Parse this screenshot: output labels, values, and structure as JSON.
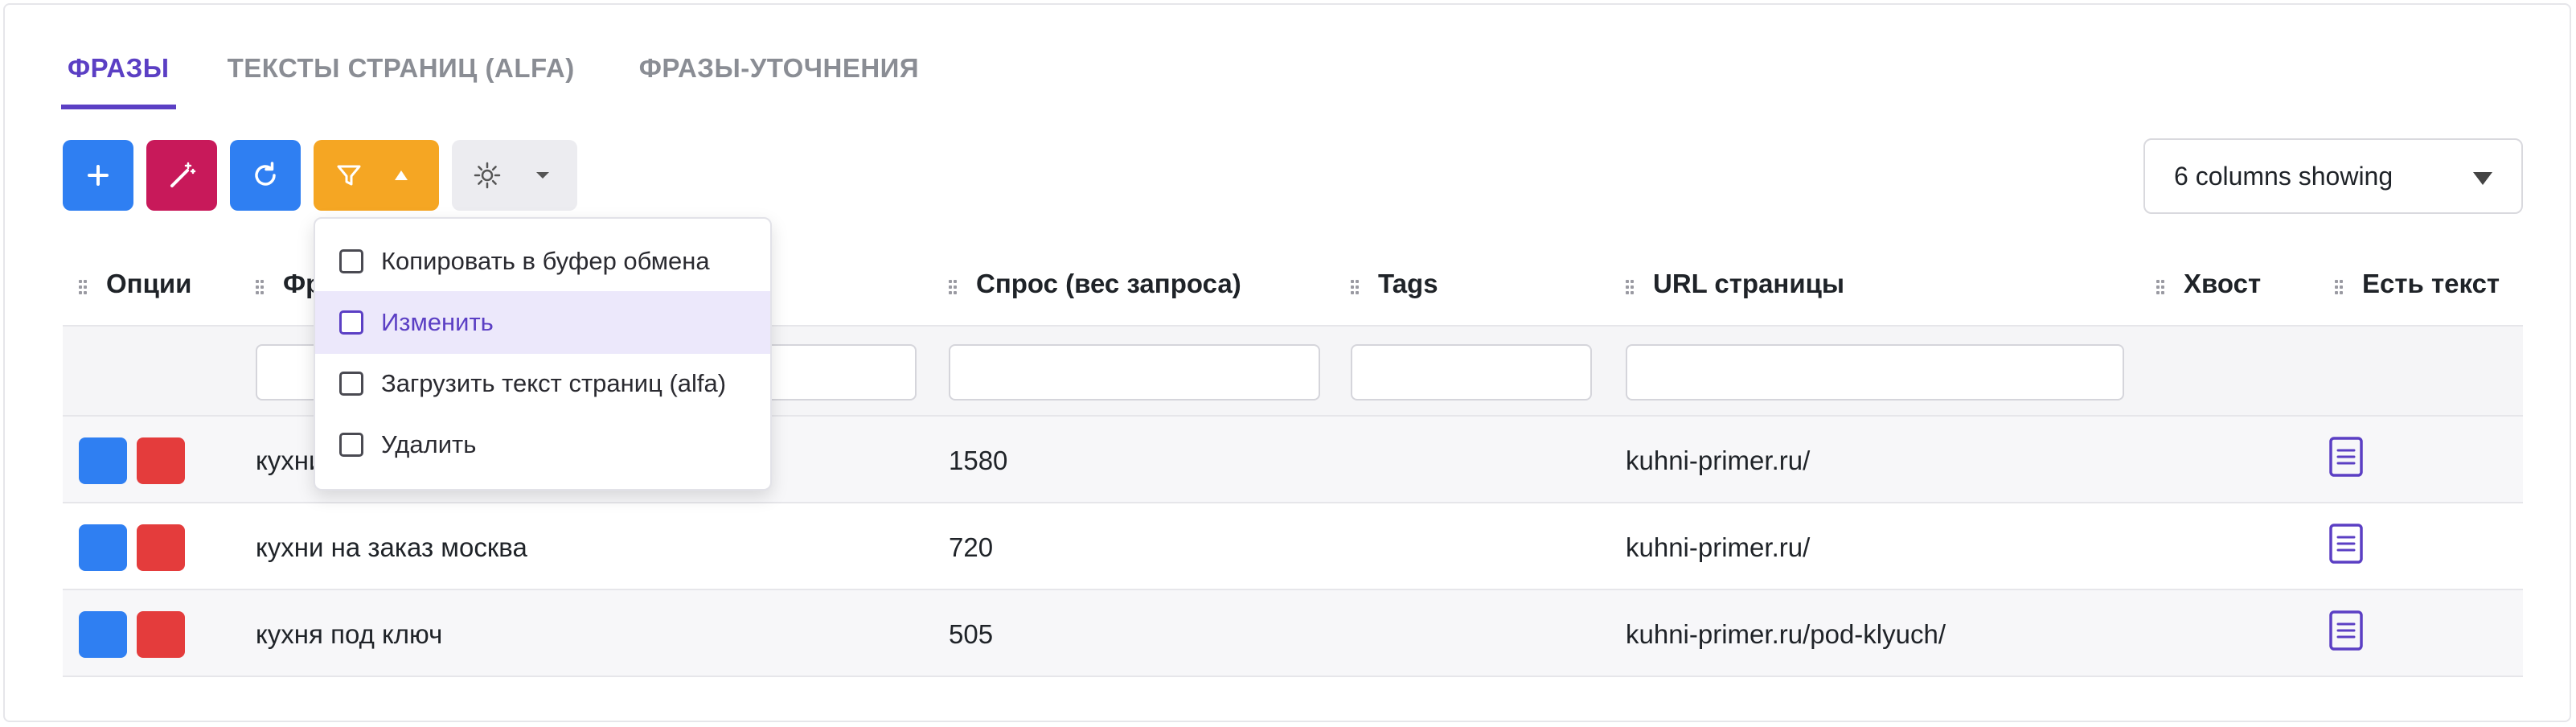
{
  "tabs": [
    {
      "label": "ФРАЗЫ"
    },
    {
      "label": "ТЕКСТЫ СТРАНИЦ (ALFA)"
    },
    {
      "label": "ФРАЗЫ-УТОЧНЕНИЯ"
    }
  ],
  "toolbar": {
    "add_icon": "plus-icon",
    "magic_icon": "wand-icon",
    "refresh_icon": "refresh-icon",
    "filter_icon": "filter-icon",
    "settings_icon": "gear-icon",
    "columns_select": "6 columns showing"
  },
  "colors": {
    "accent": "#5b3fc4",
    "blue": "#2f7ff2",
    "magenta": "#c8195a",
    "orange": "#f5a623",
    "red": "#e43c3c"
  },
  "table": {
    "headers": {
      "options": "Опции",
      "phrase": "Фраза",
      "demand": "Спрос (вес запроса)",
      "tags": "Tags",
      "url": "URL страницы",
      "tail": "Хвост",
      "has_text": "Есть текст"
    },
    "rows": [
      {
        "phrase": "кухни на заказ",
        "demand": "1580",
        "url": "kuhni-primer.ru/"
      },
      {
        "phrase": "кухни на заказ москва",
        "demand": "720",
        "url": "kuhni-primer.ru/"
      },
      {
        "phrase": "кухня под ключ",
        "demand": "505",
        "url": "kuhni-primer.ru/pod-klyuch/"
      }
    ]
  },
  "dropdown": {
    "items": [
      {
        "label": "Копировать в буфер обмена"
      },
      {
        "label": "Изменить"
      },
      {
        "label": "Загрузить текст страниц (alfa)"
      },
      {
        "label": "Удалить"
      }
    ]
  }
}
